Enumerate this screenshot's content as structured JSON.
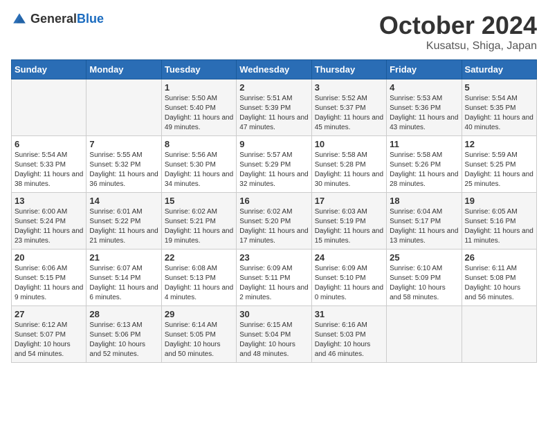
{
  "header": {
    "logo_general": "General",
    "logo_blue": "Blue",
    "month": "October 2024",
    "location": "Kusatsu, Shiga, Japan"
  },
  "days_of_week": [
    "Sunday",
    "Monday",
    "Tuesday",
    "Wednesday",
    "Thursday",
    "Friday",
    "Saturday"
  ],
  "weeks": [
    [
      {
        "num": "",
        "info": ""
      },
      {
        "num": "",
        "info": ""
      },
      {
        "num": "1",
        "info": "Sunrise: 5:50 AM\nSunset: 5:40 PM\nDaylight: 11 hours and 49 minutes."
      },
      {
        "num": "2",
        "info": "Sunrise: 5:51 AM\nSunset: 5:39 PM\nDaylight: 11 hours and 47 minutes."
      },
      {
        "num": "3",
        "info": "Sunrise: 5:52 AM\nSunset: 5:37 PM\nDaylight: 11 hours and 45 minutes."
      },
      {
        "num": "4",
        "info": "Sunrise: 5:53 AM\nSunset: 5:36 PM\nDaylight: 11 hours and 43 minutes."
      },
      {
        "num": "5",
        "info": "Sunrise: 5:54 AM\nSunset: 5:35 PM\nDaylight: 11 hours and 40 minutes."
      }
    ],
    [
      {
        "num": "6",
        "info": "Sunrise: 5:54 AM\nSunset: 5:33 PM\nDaylight: 11 hours and 38 minutes."
      },
      {
        "num": "7",
        "info": "Sunrise: 5:55 AM\nSunset: 5:32 PM\nDaylight: 11 hours and 36 minutes."
      },
      {
        "num": "8",
        "info": "Sunrise: 5:56 AM\nSunset: 5:30 PM\nDaylight: 11 hours and 34 minutes."
      },
      {
        "num": "9",
        "info": "Sunrise: 5:57 AM\nSunset: 5:29 PM\nDaylight: 11 hours and 32 minutes."
      },
      {
        "num": "10",
        "info": "Sunrise: 5:58 AM\nSunset: 5:28 PM\nDaylight: 11 hours and 30 minutes."
      },
      {
        "num": "11",
        "info": "Sunrise: 5:58 AM\nSunset: 5:26 PM\nDaylight: 11 hours and 28 minutes."
      },
      {
        "num": "12",
        "info": "Sunrise: 5:59 AM\nSunset: 5:25 PM\nDaylight: 11 hours and 25 minutes."
      }
    ],
    [
      {
        "num": "13",
        "info": "Sunrise: 6:00 AM\nSunset: 5:24 PM\nDaylight: 11 hours and 23 minutes."
      },
      {
        "num": "14",
        "info": "Sunrise: 6:01 AM\nSunset: 5:22 PM\nDaylight: 11 hours and 21 minutes."
      },
      {
        "num": "15",
        "info": "Sunrise: 6:02 AM\nSunset: 5:21 PM\nDaylight: 11 hours and 19 minutes."
      },
      {
        "num": "16",
        "info": "Sunrise: 6:02 AM\nSunset: 5:20 PM\nDaylight: 11 hours and 17 minutes."
      },
      {
        "num": "17",
        "info": "Sunrise: 6:03 AM\nSunset: 5:19 PM\nDaylight: 11 hours and 15 minutes."
      },
      {
        "num": "18",
        "info": "Sunrise: 6:04 AM\nSunset: 5:17 PM\nDaylight: 11 hours and 13 minutes."
      },
      {
        "num": "19",
        "info": "Sunrise: 6:05 AM\nSunset: 5:16 PM\nDaylight: 11 hours and 11 minutes."
      }
    ],
    [
      {
        "num": "20",
        "info": "Sunrise: 6:06 AM\nSunset: 5:15 PM\nDaylight: 11 hours and 9 minutes."
      },
      {
        "num": "21",
        "info": "Sunrise: 6:07 AM\nSunset: 5:14 PM\nDaylight: 11 hours and 6 minutes."
      },
      {
        "num": "22",
        "info": "Sunrise: 6:08 AM\nSunset: 5:13 PM\nDaylight: 11 hours and 4 minutes."
      },
      {
        "num": "23",
        "info": "Sunrise: 6:09 AM\nSunset: 5:11 PM\nDaylight: 11 hours and 2 minutes."
      },
      {
        "num": "24",
        "info": "Sunrise: 6:09 AM\nSunset: 5:10 PM\nDaylight: 11 hours and 0 minutes."
      },
      {
        "num": "25",
        "info": "Sunrise: 6:10 AM\nSunset: 5:09 PM\nDaylight: 10 hours and 58 minutes."
      },
      {
        "num": "26",
        "info": "Sunrise: 6:11 AM\nSunset: 5:08 PM\nDaylight: 10 hours and 56 minutes."
      }
    ],
    [
      {
        "num": "27",
        "info": "Sunrise: 6:12 AM\nSunset: 5:07 PM\nDaylight: 10 hours and 54 minutes."
      },
      {
        "num": "28",
        "info": "Sunrise: 6:13 AM\nSunset: 5:06 PM\nDaylight: 10 hours and 52 minutes."
      },
      {
        "num": "29",
        "info": "Sunrise: 6:14 AM\nSunset: 5:05 PM\nDaylight: 10 hours and 50 minutes."
      },
      {
        "num": "30",
        "info": "Sunrise: 6:15 AM\nSunset: 5:04 PM\nDaylight: 10 hours and 48 minutes."
      },
      {
        "num": "31",
        "info": "Sunrise: 6:16 AM\nSunset: 5:03 PM\nDaylight: 10 hours and 46 minutes."
      },
      {
        "num": "",
        "info": ""
      },
      {
        "num": "",
        "info": ""
      }
    ]
  ]
}
